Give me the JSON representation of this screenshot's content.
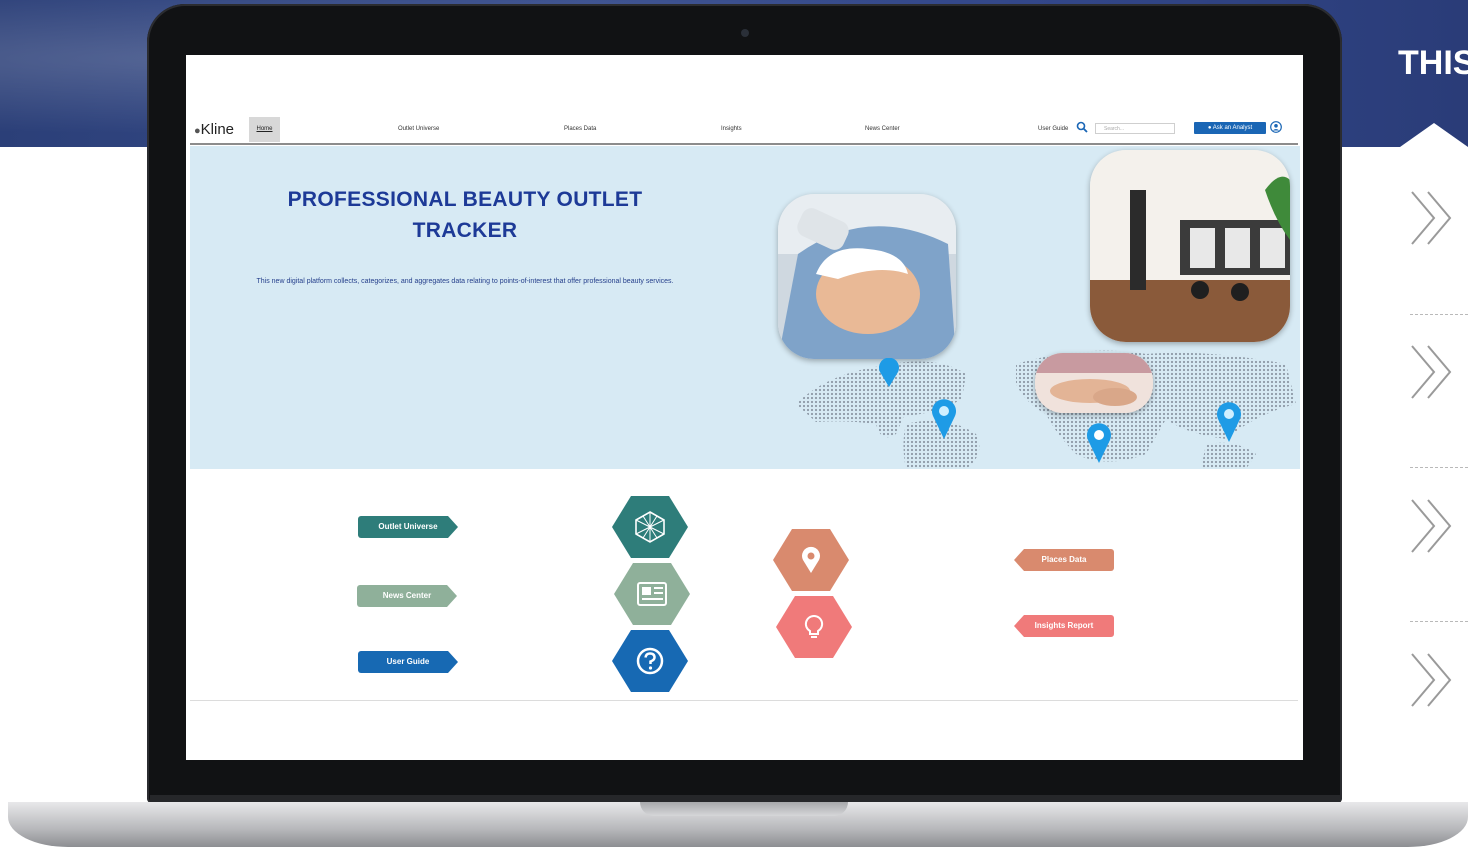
{
  "marketing": {
    "title_fragment": "THIS",
    "accent_color": "#2f4488",
    "chevron_icons": [
      "chevron-right-icon",
      "chevron-right-icon",
      "chevron-right-icon",
      "chevron-right-icon"
    ]
  },
  "app": {
    "logo_text": "Kline",
    "nav": {
      "home": "Home",
      "items": [
        "Outlet Universe",
        "Places Data",
        "Insights",
        "News Center"
      ],
      "user_guide": "User Guide",
      "search_placeholder": "Search...",
      "ask_button": "Ask an Analyst"
    },
    "hero": {
      "title_line1": "PROFESSIONAL BEAUTY OUTLET",
      "title_line2": "TRACKER",
      "description": "This new digital platform collects, categorizes, and aggregates data relating to points-of-interest that offer professional beauty services."
    },
    "quick_links": {
      "left": [
        {
          "label": "Outlet Universe",
          "color": "#2e7d7a"
        },
        {
          "label": "News Center",
          "color": "#8fb09a"
        },
        {
          "label": "User Guide",
          "color": "#1769b3"
        }
      ],
      "right": [
        {
          "label": "Places Data",
          "color": "#d98a6e"
        },
        {
          "label": "Insights Report",
          "color": "#f07a7a"
        }
      ],
      "hex_icons": [
        {
          "icon": "cube-network-icon",
          "color": "#2e7d7a"
        },
        {
          "icon": "newspaper-icon",
          "color": "#8fb09a"
        },
        {
          "icon": "question-icon",
          "color": "#1769b3"
        },
        {
          "icon": "map-pin-icon",
          "color": "#d98a6e"
        },
        {
          "icon": "lightbulb-icon",
          "color": "#f07a7a"
        }
      ]
    }
  }
}
